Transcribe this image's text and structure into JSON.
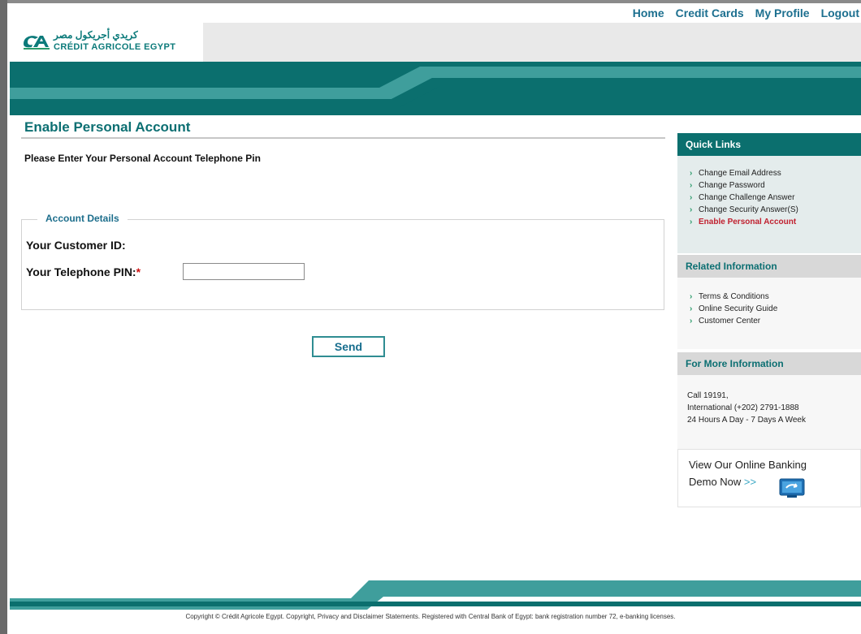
{
  "topnav": {
    "items": [
      "Home",
      "Credit Cards",
      "My Profile",
      "Logout"
    ]
  },
  "brand": {
    "name_arabic": "كريدي أجريكول مصر",
    "name_latin": "CRÉDIT AGRICOLE EGYPT",
    "primary_color": "#0b6f6e"
  },
  "main": {
    "title": "Enable Personal Account",
    "instruction": "Please Enter Your Personal Account Telephone Pin",
    "fieldset_legend": "Account Details",
    "customer_id_label": "Your Customer ID:",
    "customer_id_value": "",
    "pin_label": "Your Telephone PIN:",
    "required_marker": "*",
    "pin_value": "",
    "send_label": "Send"
  },
  "sidebar": {
    "quick_links": {
      "title": "Quick Links",
      "items": [
        "Change Email Address",
        "Change Password",
        "Change Challenge Answer",
        "Change Security Answer(S)",
        "Enable Personal Account"
      ],
      "active_index": 4
    },
    "related": {
      "title": "Related Information",
      "items": [
        "Terms & Conditions",
        "Online Security Guide",
        "Customer Center"
      ]
    },
    "more_info": {
      "title": "For More Information",
      "lines": [
        "Call 19191,",
        "International (+202) 2791-1888",
        "24 Hours A Day - 7 Days A Week"
      ]
    },
    "demo": {
      "line1": "View Our Online Banking",
      "line2": "Demo Now",
      "arrows": ">>"
    }
  },
  "footer": {
    "text": "Copyright © Crédit Agricole Egypt. Copyright, Privacy and Disclaimer Statements. Registered with Central Bank of Egypt: bank registration number 72, e-banking licenses."
  }
}
